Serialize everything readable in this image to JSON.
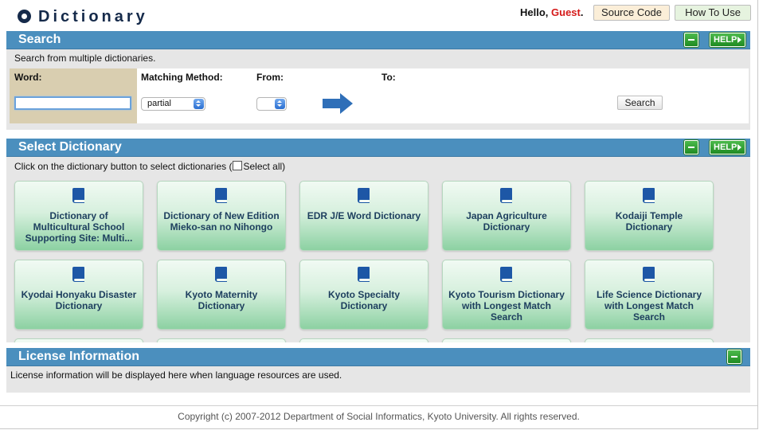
{
  "header": {
    "title": "Dictionary",
    "hello_prefix": "Hello, ",
    "user": "Guest",
    "hello_suffix": ".",
    "source_code": "Source Code",
    "how_to_use": "How To Use"
  },
  "search": {
    "title": "Search",
    "help": "HELP",
    "intro": "Search from multiple dictionaries.",
    "word_label": "Word:",
    "word_value": "",
    "method_label": "Matching Method:",
    "method_value": "partial",
    "from_label": "From:",
    "from_value": "",
    "to_label": "To:",
    "button": "Search"
  },
  "select_dictionary": {
    "title": "Select Dictionary",
    "help": "HELP",
    "instruction_pre": "Click on the dictionary button to select dictionaries (",
    "select_all": "Select all)",
    "tiles": [
      [
        "Dictionary of",
        "Multicultural School",
        "Supporting Site: Multi..."
      ],
      [
        "Dictionary of New Edition",
        "Mieko-san no Nihongo"
      ],
      [
        "EDR J/E Word Dictionary"
      ],
      [
        "Japan Agriculture",
        "Dictionary"
      ],
      [
        "Kodaiji Temple",
        "Dictionary"
      ],
      [
        "Kyodai Honyaku Disaster",
        "Dictionary"
      ],
      [
        "Kyoto Maternity",
        "Dictionary"
      ],
      [
        "Kyoto Specialty",
        "Dictionary"
      ],
      [
        "Kyoto Tourism Dictionary",
        "with Longest Match",
        "Search"
      ],
      [
        "Life Science Dictionary",
        "with Longest Match",
        "Search"
      ]
    ]
  },
  "license": {
    "title": "License Information",
    "text": "License information will be displayed here when language resources are used."
  },
  "footer": {
    "copyright": "Copyright (c) 2007-2012 Department of Social Informatics, Kyoto University. All rights reserved."
  },
  "colors": {
    "panel_bar": "#4b8fbe",
    "header_text": "#152a4a",
    "guest": "#d51a1a",
    "tile_label": "#1d3e5e",
    "arrow": "#2f6fb8"
  },
  "icons": {
    "logo": "logo-icon",
    "arrow": "arrow-right-icon",
    "book": "book-icon",
    "minus": "minus-icon"
  }
}
